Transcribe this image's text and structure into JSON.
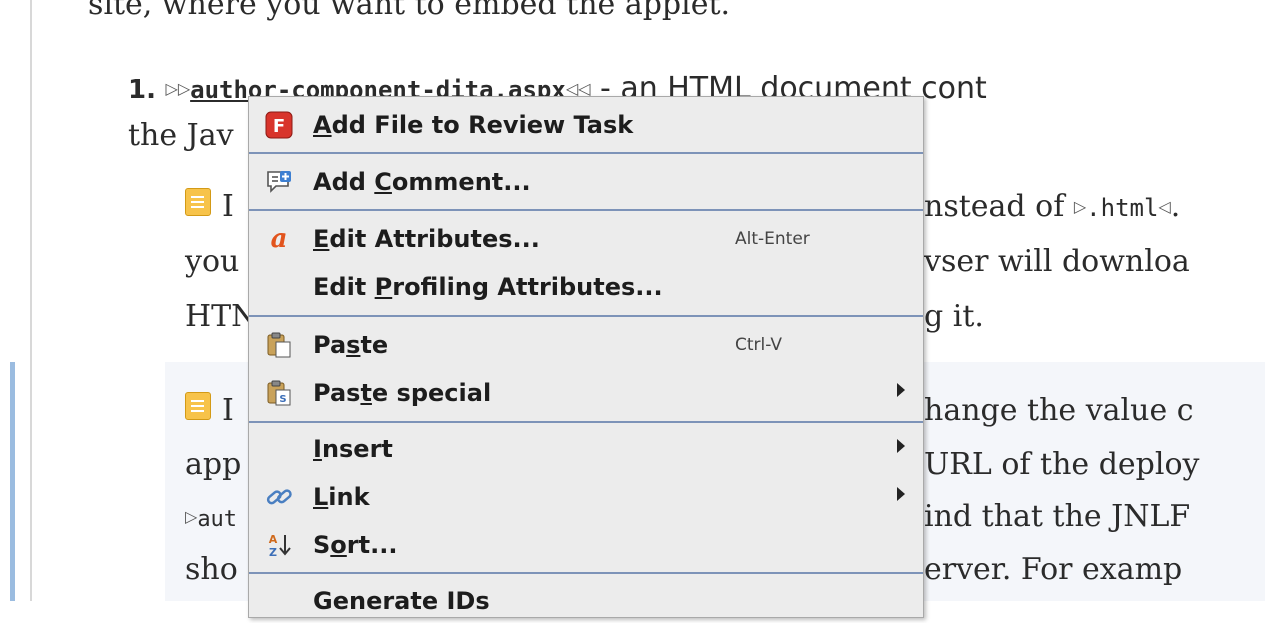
{
  "document": {
    "top_line": "site, where you want to embed the applet.",
    "item_number": "1.",
    "file_name": "author-component-dita.aspx",
    "item_rest": " - an HTML document cont",
    "line2_start": "the Jav",
    "note1": {
      "line1_start": "I",
      "line1_end": "nstead of ",
      "code": ".html",
      "line1_tail": ".",
      "line2_start": "you",
      "line2_end": "vser will downloa",
      "line3_start": "HTN",
      "line3_end": "g it."
    },
    "note2": {
      "line1_start": "I",
      "line1_end": "hange the value c",
      "line2_start": "app",
      "line2_end": "URL of the deploy",
      "line3_start": "aut",
      "line3_end": "ind that the JNLF",
      "line4_start": "sho",
      "line4_end": "erver. For examp"
    }
  },
  "context_menu": {
    "items": [
      {
        "pre": "",
        "key": "A",
        "post": "dd File to Review Task",
        "shortcut": "",
        "submenu": false,
        "icon": "review-task-icon"
      },
      {
        "pre": "Add ",
        "key": "C",
        "post": "omment...",
        "shortcut": "",
        "submenu": false,
        "icon": "add-comment-icon"
      },
      {
        "pre": "",
        "key": "E",
        "post": "dit Attributes...",
        "shortcut": "Alt-Enter",
        "submenu": false,
        "icon": "attributes-icon"
      },
      {
        "pre": "Edit ",
        "key": "P",
        "post": "rofiling Attributes...",
        "shortcut": "",
        "submenu": false,
        "icon": ""
      },
      {
        "pre": "Pa",
        "key": "s",
        "post": "te",
        "shortcut": "Ctrl-V",
        "submenu": false,
        "icon": "paste-icon"
      },
      {
        "pre": "Pas",
        "key": "t",
        "post": "e special",
        "shortcut": "",
        "submenu": true,
        "icon": "paste-special-icon"
      },
      {
        "pre": "",
        "key": "I",
        "post": "nsert",
        "shortcut": "",
        "submenu": true,
        "icon": ""
      },
      {
        "pre": "",
        "key": "L",
        "post": "ink",
        "shortcut": "",
        "submenu": true,
        "icon": "link-icon"
      },
      {
        "pre": "S",
        "key": "o",
        "post": "rt...",
        "shortcut": "",
        "submenu": false,
        "icon": "sort-icon"
      },
      {
        "pre": "Generate IDs",
        "key": "",
        "post": "",
        "shortcut": "",
        "submenu": false,
        "icon": ""
      }
    ]
  }
}
